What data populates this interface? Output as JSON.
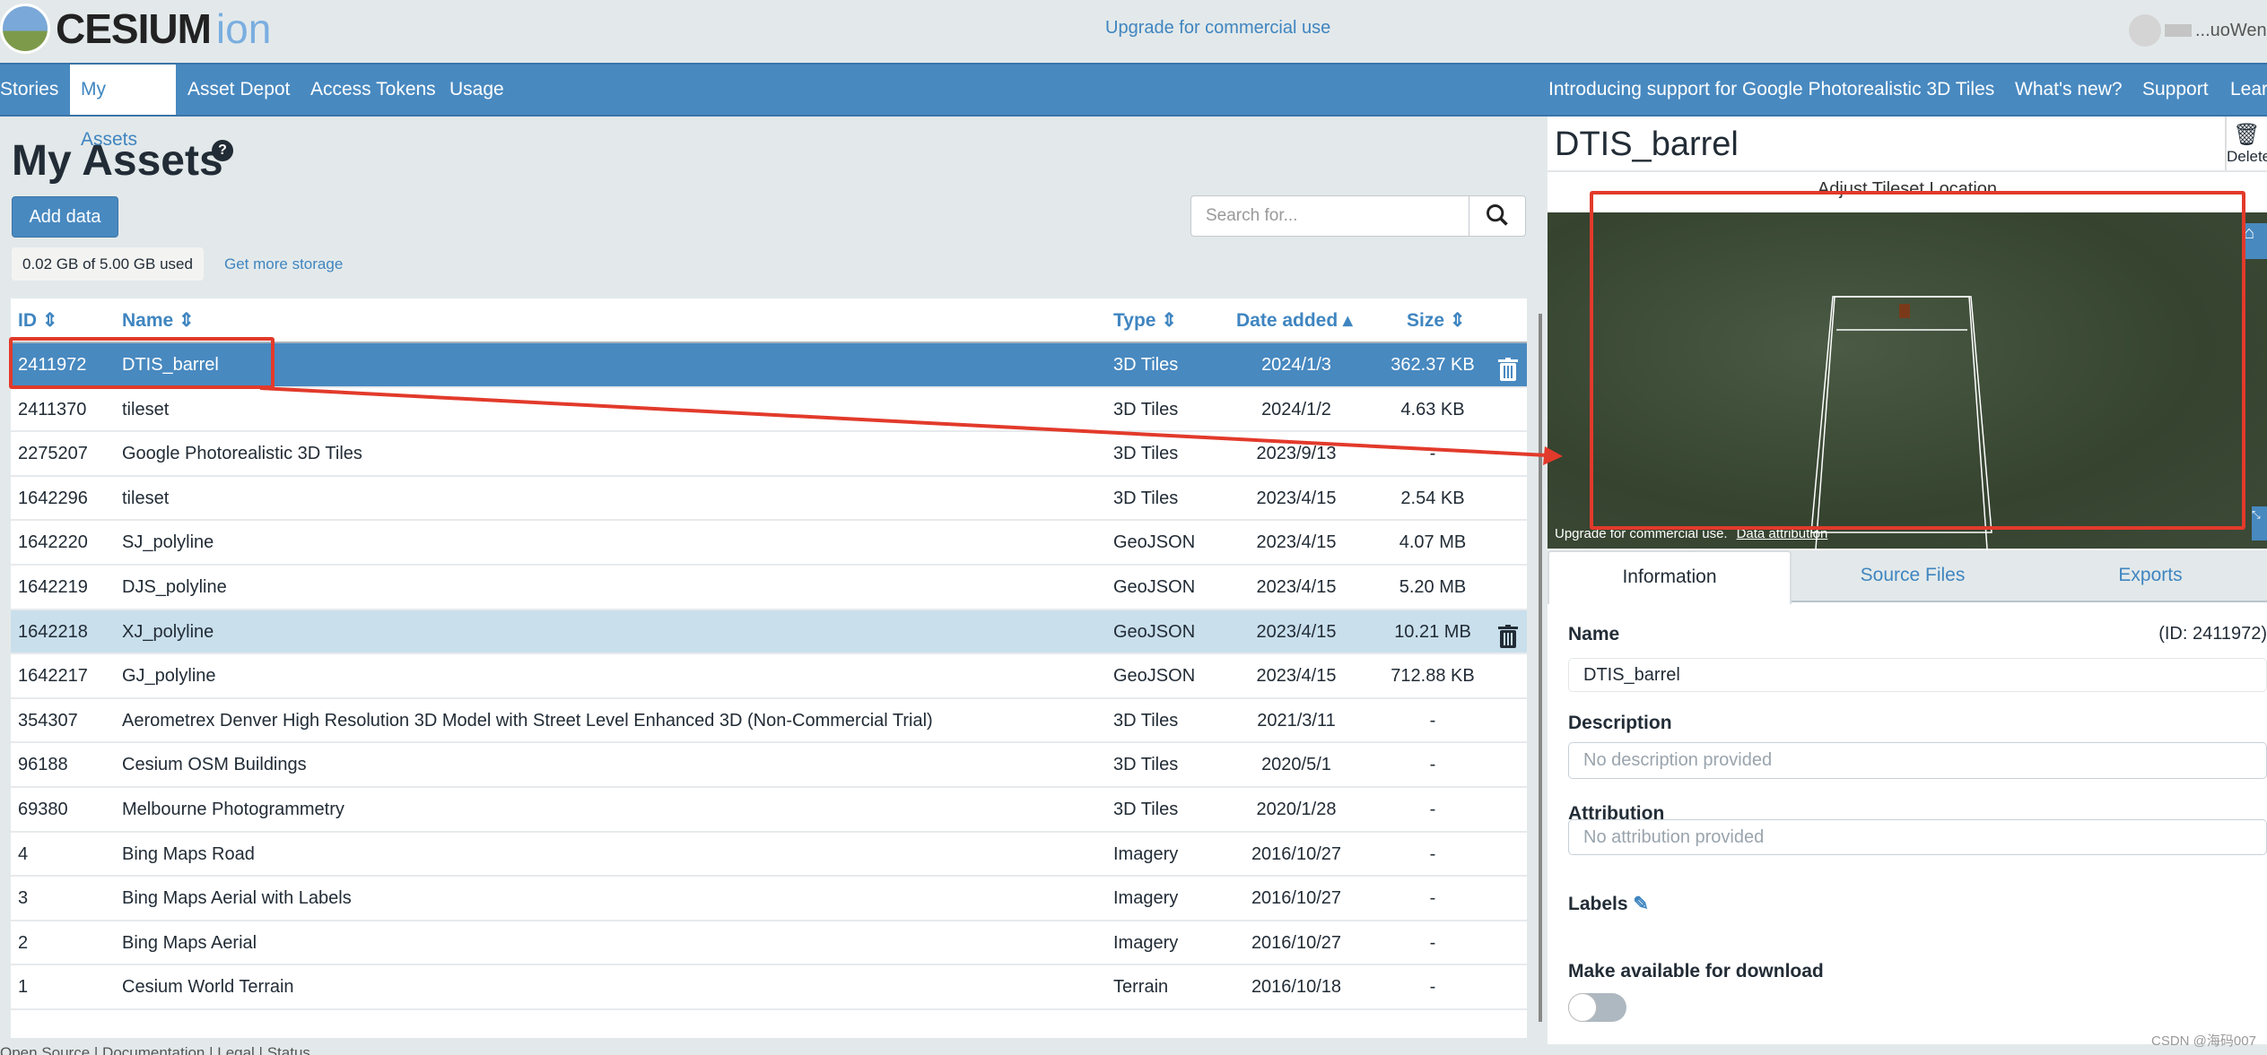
{
  "header": {
    "logo_text": "CESIUM",
    "logo_suffix": "ion",
    "upgrade_link": "Upgrade for commercial use",
    "username": "...uoWen"
  },
  "nav": {
    "left": [
      "Stories",
      "My Assets",
      "Asset Depot",
      "Access Tokens",
      "Usage"
    ],
    "active": "My Assets",
    "right": [
      "Introducing support for Google Photorealistic 3D Tiles",
      "What's new?",
      "Support",
      "Learn"
    ]
  },
  "main": {
    "title": "My Assets",
    "help_icon": "?",
    "add_data": "Add data",
    "storage": "0.02 GB of 5.00 GB used",
    "more_storage": "Get more storage",
    "search_placeholder": "Search for...",
    "columns": [
      "ID",
      "Name",
      "Type",
      "Date added",
      "Size"
    ],
    "sort_column": "Date added",
    "selected_row": 0,
    "hovered_row": 6,
    "rows": [
      [
        "2411972",
        "DTIS_barrel",
        "3D Tiles",
        "2024/1/3",
        "362.37 KB"
      ],
      [
        "2411370",
        "tileset",
        "3D Tiles",
        "2024/1/2",
        "4.63 KB"
      ],
      [
        "2275207",
        "Google Photorealistic 3D Tiles",
        "3D Tiles",
        "2023/9/13",
        "-"
      ],
      [
        "1642296",
        "tileset",
        "3D Tiles",
        "2023/4/15",
        "2.54 KB"
      ],
      [
        "1642220",
        "SJ_polyline",
        "GeoJSON",
        "2023/4/15",
        "4.07 MB"
      ],
      [
        "1642219",
        "DJS_polyline",
        "GeoJSON",
        "2023/4/15",
        "5.20 MB"
      ],
      [
        "1642218",
        "XJ_polyline",
        "GeoJSON",
        "2023/4/15",
        "10.21 MB"
      ],
      [
        "1642217",
        "GJ_polyline",
        "GeoJSON",
        "2023/4/15",
        "712.88 KB"
      ],
      [
        "354307",
        "Aerometrex Denver High Resolution 3D Model with Street Level Enhanced 3D (Non-Commercial Trial)",
        "3D Tiles",
        "2021/3/11",
        "-"
      ],
      [
        "96188",
        "Cesium OSM Buildings",
        "3D Tiles",
        "2020/5/1",
        "-"
      ],
      [
        "69380",
        "Melbourne Photogrammetry",
        "3D Tiles",
        "2020/1/28",
        "-"
      ],
      [
        "4",
        "Bing Maps Road",
        "Imagery",
        "2016/10/27",
        "-"
      ],
      [
        "3",
        "Bing Maps Aerial with Labels",
        "Imagery",
        "2016/10/27",
        "-"
      ],
      [
        "2",
        "Bing Maps Aerial",
        "Imagery",
        "2016/10/27",
        "-"
      ],
      [
        "1",
        "Cesium World Terrain",
        "Terrain",
        "2016/10/18",
        "-"
      ]
    ]
  },
  "footer": "Open Source | Documentation | Legal | Status",
  "panel": {
    "title": "DTIS_barrel",
    "delete": "Delete",
    "viewer_title": "Adjust Tileset Location",
    "viewer_credit": "Upgrade for commercial use.",
    "data_attribution": "Data attribution",
    "tabs": [
      "Information",
      "Source Files",
      "Exports"
    ],
    "active_tab": "Information",
    "name_label": "Name",
    "id_text": "(ID:   2411972)",
    "name_value": "DTIS_barrel",
    "description_label": "Description",
    "description_placeholder": "No description provided",
    "attribution_label": "Attribution",
    "attribution_placeholder": "No attribution provided",
    "labels_label": "Labels",
    "download_label": "Make available for download",
    "download_enabled": false
  },
  "watermark": "CSDN @海码007",
  "colors": {
    "brand": "#4889c0",
    "link": "#3f85c0",
    "annotation": "#e23a2b"
  }
}
